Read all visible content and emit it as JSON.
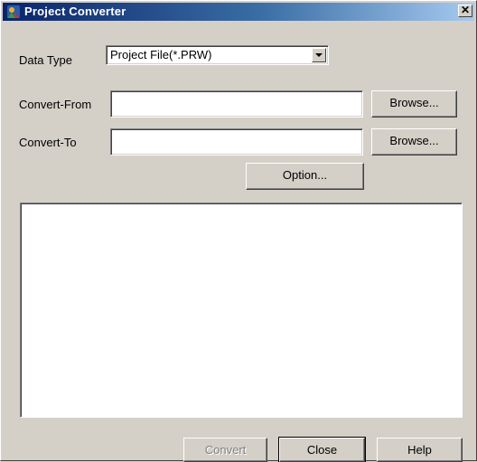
{
  "window": {
    "title": "Project Converter",
    "close_glyph": "✕"
  },
  "data_type": {
    "label": "Data Type",
    "selected": "Project File(*.PRW)"
  },
  "convert_from": {
    "label": "Convert-From",
    "value": "",
    "browse_label": "Browse..."
  },
  "convert_to": {
    "label": "Convert-To",
    "value": "",
    "browse_label": "Browse..."
  },
  "option_label": "Option...",
  "buttons": {
    "convert": "Convert",
    "close": "Close",
    "help": "Help"
  }
}
